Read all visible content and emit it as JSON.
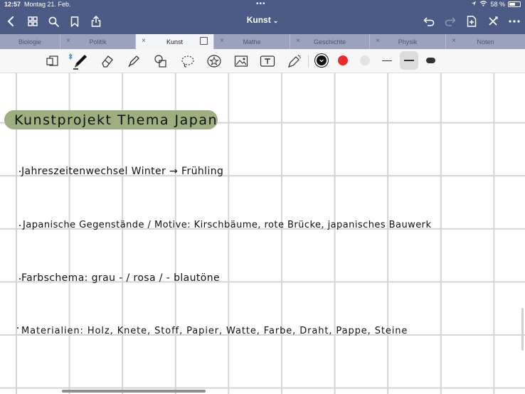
{
  "status": {
    "time": "12:57",
    "date": "Montag 21. Feb.",
    "battery": "58 %",
    "multitask_dots": "•••"
  },
  "document": {
    "title": "Kunst",
    "title_chevron": "⌄"
  },
  "tabs": [
    {
      "label": "Biologie",
      "active": false
    },
    {
      "label": "Politik",
      "active": false
    },
    {
      "label": "Kunst",
      "active": true
    },
    {
      "label": "Mathe",
      "active": false
    },
    {
      "label": "Geschichte",
      "active": false
    },
    {
      "label": "Physik",
      "active": false
    },
    {
      "label": "Noten",
      "active": false
    }
  ],
  "toolbar": {
    "colors": [
      "#111111",
      "#ee2a2a",
      "#e2e2e2"
    ],
    "selected_color": "#111111"
  },
  "notes": {
    "heading": "Kunstprojekt Thema Japan",
    "heading_highlight": "#9fae7f",
    "lines": [
      "Jahreszeitenwechsel  Winter → Frühling",
      "Japanische Gegenstände / Motive: Kirschbäume, rote Brücke, japanisches Bauwerk",
      "Farbschema: grau - / rosa / - blautöne",
      "Materialien: Holz, Knete, Stoff, Papier, Watte, Farbe, Draht, Pappe, Steine"
    ]
  }
}
